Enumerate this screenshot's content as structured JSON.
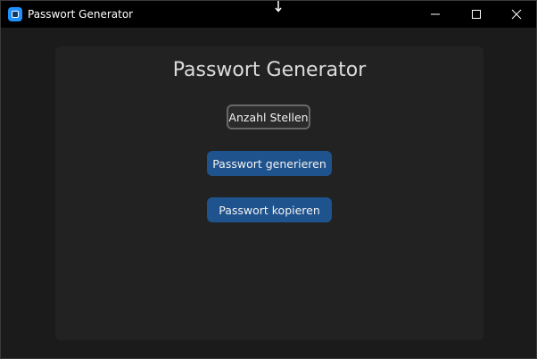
{
  "window": {
    "title": "Passwort Generator",
    "app_icon": "app-icon",
    "controls": [
      "minimize-icon",
      "maximize-icon",
      "close-icon"
    ]
  },
  "main": {
    "heading": "Passwort Generator",
    "digits_button": "Anzahl Stellen",
    "generate_button": "Passwort generieren",
    "copy_button": "Passwort kopieren"
  },
  "colors": {
    "titlebar": "#000000",
    "background": "#1b1b1b",
    "panel": "#222222",
    "primary_button": "#1f538d",
    "outline_border": "#686868",
    "text": "#dcdcdc"
  }
}
